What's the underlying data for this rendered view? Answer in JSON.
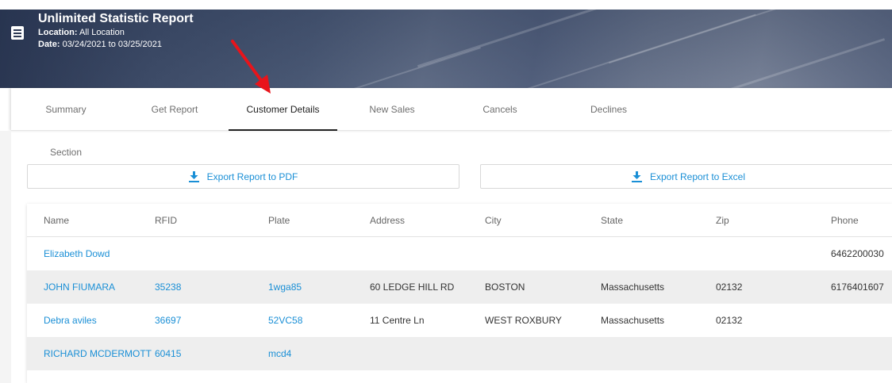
{
  "header": {
    "title": "Unlimited Statistic Report",
    "location_label": "Location:",
    "location_value": " All Location",
    "date_label": "Date:",
    "date_value": " 03/24/2021 to 03/25/2021"
  },
  "tabs": [
    {
      "label": "Summary Section"
    },
    {
      "label": "Get Report"
    },
    {
      "label": "Customer Details",
      "active": true
    },
    {
      "label": "New Sales"
    },
    {
      "label": "Cancels"
    },
    {
      "label": "Declines"
    }
  ],
  "exports": {
    "pdf_label": "Export Report to PDF",
    "excel_label": "Export Report to Excel"
  },
  "table": {
    "columns": [
      "Name",
      "RFID",
      "Plate",
      "Address",
      "City",
      "State",
      "Zip",
      "Phone"
    ],
    "rows": [
      [
        "Elizabeth Dowd",
        "",
        "",
        "",
        "",
        "",
        "",
        "6462200030"
      ],
      [
        "JOHN FIUMARA",
        "35238",
        "1wga85",
        "60 LEDGE HILL RD",
        "BOSTON",
        "Massachusetts",
        "02132",
        "6176401607"
      ],
      [
        "Debra aviles",
        "36697",
        "52VC58",
        "11 Centre Ln",
        "WEST ROXBURY",
        "Massachusetts",
        "02132",
        ""
      ],
      [
        "RICHARD MCDERMOTT",
        "60415",
        "mcd4",
        "",
        "",
        "",
        "",
        ""
      ]
    ]
  },
  "colors": {
    "accent": "#1a8fd6",
    "annotation_arrow": "#e8141b"
  }
}
